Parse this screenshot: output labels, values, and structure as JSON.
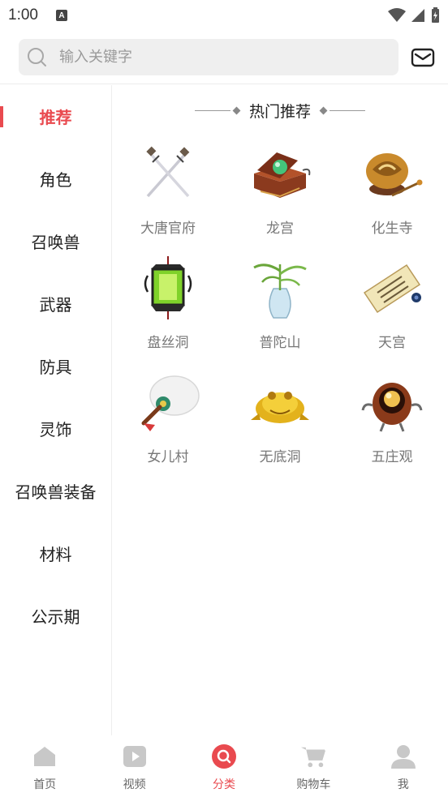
{
  "status": {
    "time": "1:00",
    "a_badge": "A"
  },
  "search": {
    "placeholder": "输入关键字"
  },
  "sidebar": {
    "items": [
      {
        "label": "推荐",
        "active": true
      },
      {
        "label": "角色"
      },
      {
        "label": "召唤兽"
      },
      {
        "label": "武器"
      },
      {
        "label": "防具"
      },
      {
        "label": "灵饰"
      },
      {
        "label": "召唤兽装备"
      },
      {
        "label": "材料"
      },
      {
        "label": "公示期"
      }
    ]
  },
  "section": {
    "title": "热门推荐"
  },
  "grid": {
    "items": [
      {
        "label": "大唐官府",
        "icon": "crossed-swords-icon"
      },
      {
        "label": "龙宫",
        "icon": "jewel-box-icon"
      },
      {
        "label": "化生寺",
        "icon": "wooden-fish-icon"
      },
      {
        "label": "盘丝洞",
        "icon": "green-lantern-icon"
      },
      {
        "label": "普陀山",
        "icon": "willow-vase-icon"
      },
      {
        "label": "天宫",
        "icon": "scroll-icon"
      },
      {
        "label": "女儿村",
        "icon": "feather-fan-icon"
      },
      {
        "label": "无底洞",
        "icon": "golden-toad-icon"
      },
      {
        "label": "五庄观",
        "icon": "gourd-pearl-icon"
      }
    ]
  },
  "bottom_nav": {
    "items": [
      {
        "label": "首页",
        "icon": "home-icon"
      },
      {
        "label": "视频",
        "icon": "video-icon"
      },
      {
        "label": "分类",
        "icon": "category-search-icon",
        "active": true
      },
      {
        "label": "购物车",
        "icon": "cart-icon"
      },
      {
        "label": "我",
        "icon": "profile-icon"
      }
    ]
  },
  "colors": {
    "accent": "#e94a4f",
    "inactive_icon": "#c8c8c8",
    "label_gray": "#777777"
  }
}
